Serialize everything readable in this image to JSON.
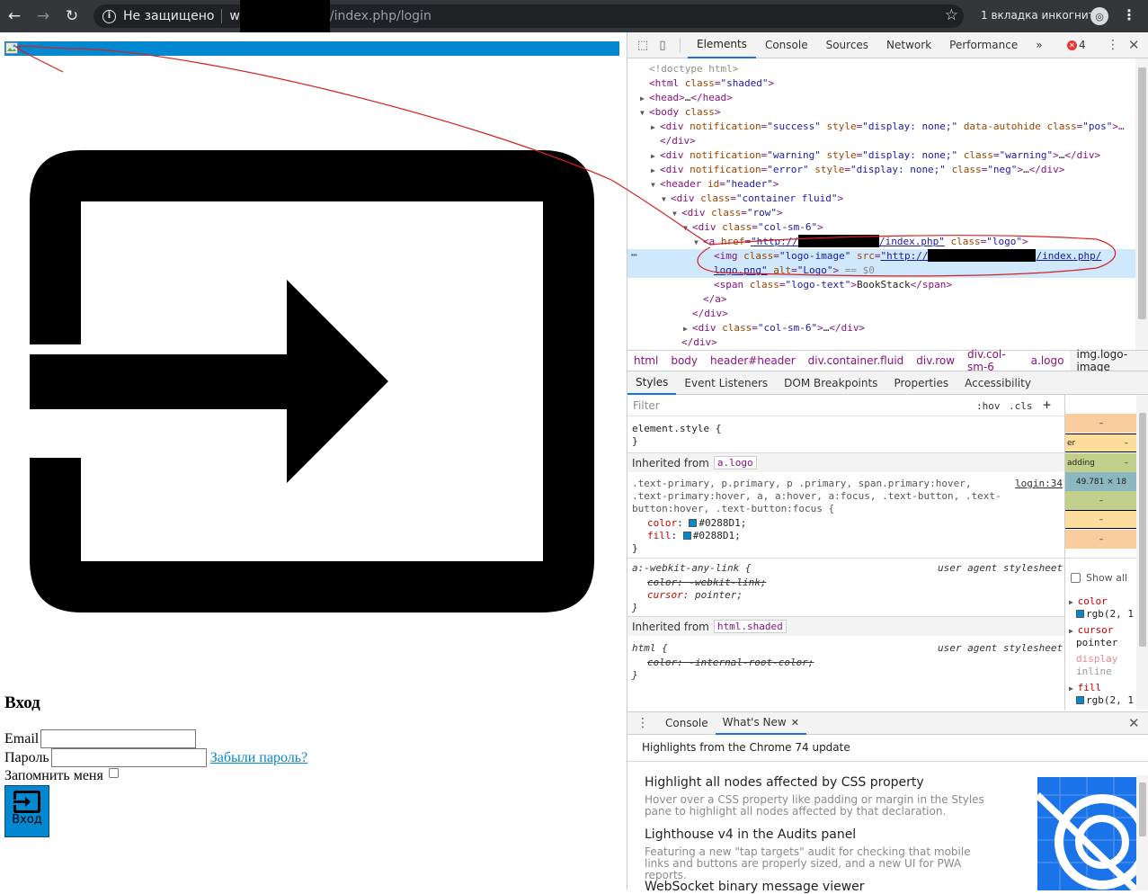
{
  "browser": {
    "security_label": "Не защищено",
    "url_prefix": "w",
    "url_path": "/index.php/login",
    "incognito_label": "1 вкладка инкогнито"
  },
  "page": {
    "login_title": "Вход",
    "email_label": "Email",
    "password_label": "Пароль",
    "forgot_link": "Забыли пароль?",
    "remember_label": "Запомнить меня",
    "login_button": "Вход",
    "accent_color": "#0288D1"
  },
  "devtools": {
    "tabs": [
      "Elements",
      "Console",
      "Sources",
      "Network",
      "Performance",
      "»"
    ],
    "error_count": "4",
    "dom": [
      {
        "indent": 0,
        "arrow": "",
        "parts": [
          [
            "cmt",
            "<!doctype html>"
          ]
        ]
      },
      {
        "indent": 0,
        "arrow": "",
        "parts": [
          [
            "tag",
            "<html "
          ],
          [
            "attr",
            "class"
          ],
          [
            "tag",
            "="
          ],
          [
            "val",
            "\"shaded\""
          ],
          [
            "tag",
            ">"
          ]
        ]
      },
      {
        "indent": 0,
        "arrow": "▶",
        "parts": [
          [
            "tag",
            "<head>"
          ],
          [
            "txt",
            "…"
          ],
          [
            "tag",
            "</head>"
          ]
        ]
      },
      {
        "indent": 0,
        "arrow": "▼",
        "parts": [
          [
            "tag",
            "<body "
          ],
          [
            "attr",
            "class"
          ],
          [
            "tag",
            ">"
          ]
        ]
      },
      {
        "indent": 1,
        "arrow": "▶",
        "parts": [
          [
            "tag",
            "<div "
          ],
          [
            "attr",
            "notification"
          ],
          [
            "tag",
            "="
          ],
          [
            "val",
            "\"success\""
          ],
          [
            "tag",
            " "
          ],
          [
            "attr",
            "style"
          ],
          [
            "tag",
            "="
          ],
          [
            "val",
            "\"display: none;\""
          ],
          [
            "tag",
            " "
          ],
          [
            "attr",
            "data-autohide"
          ],
          [
            "tag",
            " "
          ],
          [
            "attr",
            "class"
          ],
          [
            "tag",
            "="
          ],
          [
            "val",
            "\"pos\""
          ],
          [
            "tag",
            ">…"
          ]
        ]
      },
      {
        "indent": 1,
        "arrow": "",
        "parts": [
          [
            "tag",
            "</div>"
          ]
        ]
      },
      {
        "indent": 1,
        "arrow": "▶",
        "parts": [
          [
            "tag",
            "<div "
          ],
          [
            "attr",
            "notification"
          ],
          [
            "tag",
            "="
          ],
          [
            "val",
            "\"warning\""
          ],
          [
            "tag",
            " "
          ],
          [
            "attr",
            "style"
          ],
          [
            "tag",
            "="
          ],
          [
            "val",
            "\"display: none;\""
          ],
          [
            "tag",
            " "
          ],
          [
            "attr",
            "class"
          ],
          [
            "tag",
            "="
          ],
          [
            "val",
            "\"warning\""
          ],
          [
            "tag",
            ">"
          ],
          [
            "txt",
            "…"
          ],
          [
            "tag",
            "</div>"
          ]
        ]
      },
      {
        "indent": 1,
        "arrow": "▶",
        "parts": [
          [
            "tag",
            "<div "
          ],
          [
            "attr",
            "notification"
          ],
          [
            "tag",
            "="
          ],
          [
            "val",
            "\"error\""
          ],
          [
            "tag",
            " "
          ],
          [
            "attr",
            "style"
          ],
          [
            "tag",
            "="
          ],
          [
            "val",
            "\"display: none;\""
          ],
          [
            "tag",
            " "
          ],
          [
            "attr",
            "class"
          ],
          [
            "tag",
            "="
          ],
          [
            "val",
            "\"neg\""
          ],
          [
            "tag",
            ">"
          ],
          [
            "txt",
            "…"
          ],
          [
            "tag",
            "</div>"
          ]
        ]
      },
      {
        "indent": 1,
        "arrow": "▼",
        "parts": [
          [
            "tag",
            "<header "
          ],
          [
            "attr",
            "id"
          ],
          [
            "tag",
            "="
          ],
          [
            "val",
            "\"header\""
          ],
          [
            "tag",
            ">"
          ]
        ]
      },
      {
        "indent": 2,
        "arrow": "▼",
        "parts": [
          [
            "tag",
            "<div "
          ],
          [
            "attr",
            "class"
          ],
          [
            "tag",
            "="
          ],
          [
            "val",
            "\"container fluid\""
          ],
          [
            "tag",
            ">"
          ]
        ]
      },
      {
        "indent": 3,
        "arrow": "▼",
        "parts": [
          [
            "tag",
            "<div "
          ],
          [
            "attr",
            "class"
          ],
          [
            "tag",
            "="
          ],
          [
            "val",
            "\"row\""
          ],
          [
            "tag",
            ">"
          ]
        ]
      },
      {
        "indent": 4,
        "arrow": "▼",
        "parts": [
          [
            "tag",
            "<div "
          ],
          [
            "attr",
            "class"
          ],
          [
            "tag",
            "="
          ],
          [
            "val",
            "\"col-sm-6\""
          ],
          [
            "tag",
            ">"
          ]
        ]
      },
      {
        "indent": 5,
        "arrow": "▼",
        "parts": [
          [
            "tag",
            "<a "
          ],
          [
            "attr",
            "href"
          ],
          [
            "tag",
            "="
          ],
          [
            "link",
            "\"http://"
          ],
          [
            "redact",
            "████████████"
          ],
          [
            "link",
            "/index.php\""
          ],
          [
            "tag",
            " "
          ],
          [
            "attr",
            "class"
          ],
          [
            "tag",
            "="
          ],
          [
            "val",
            "\"logo\""
          ],
          [
            "tag",
            ">"
          ]
        ]
      },
      {
        "indent": 6,
        "arrow": "",
        "selected": true,
        "parts": [
          [
            "tag",
            "<img "
          ],
          [
            "attr",
            "class"
          ],
          [
            "tag",
            "="
          ],
          [
            "val",
            "\"logo-image\""
          ],
          [
            "tag",
            " "
          ],
          [
            "attr",
            "src"
          ],
          [
            "tag",
            "="
          ],
          [
            "link",
            "\"http://"
          ],
          [
            "redact",
            "████████████████"
          ],
          [
            "link",
            "/index.php/"
          ]
        ]
      },
      {
        "indent": 6,
        "arrow": "",
        "selected": true,
        "parts": [
          [
            "link",
            "logo.png\""
          ],
          [
            "tag",
            " "
          ],
          [
            "attr",
            "alt"
          ],
          [
            "tag",
            "="
          ],
          [
            "val",
            "\"Logo\""
          ],
          [
            "tag",
            ">"
          ],
          [
            "cmt",
            " == $0"
          ]
        ]
      },
      {
        "indent": 6,
        "arrow": "",
        "parts": [
          [
            "tag",
            "<span "
          ],
          [
            "attr",
            "class"
          ],
          [
            "tag",
            "="
          ],
          [
            "val",
            "\"logo-text\""
          ],
          [
            "tag",
            ">"
          ],
          [
            "txt",
            "BookStack"
          ],
          [
            "tag",
            "</span>"
          ]
        ]
      },
      {
        "indent": 5,
        "arrow": "",
        "parts": [
          [
            "tag",
            "</a>"
          ]
        ]
      },
      {
        "indent": 4,
        "arrow": "",
        "parts": [
          [
            "tag",
            "</div>"
          ]
        ]
      },
      {
        "indent": 4,
        "arrow": "▶",
        "parts": [
          [
            "tag",
            "<div "
          ],
          [
            "attr",
            "class"
          ],
          [
            "tag",
            "="
          ],
          [
            "val",
            "\"col-sm-6\""
          ],
          [
            "tag",
            ">"
          ],
          [
            "txt",
            "…"
          ],
          [
            "tag",
            "</div>"
          ]
        ]
      },
      {
        "indent": 3,
        "arrow": "",
        "parts": [
          [
            "tag",
            "</div>"
          ]
        ]
      }
    ],
    "breadcrumbs": [
      "html",
      "body",
      "header#header",
      "div.container.fluid",
      "div.row",
      "div.col-sm-6",
      "a.logo",
      "img.logo-image"
    ],
    "style_tabs": [
      "Styles",
      "Event Listeners",
      "DOM Breakpoints",
      "Properties",
      "Accessibility"
    ],
    "filter_placeholder": "Filter",
    "hov": ":hov",
    "cls": ".cls",
    "styles": {
      "element_style": "element.style {",
      "close_brace": "}",
      "inherited_label": "Inherited from",
      "inherited_a": "a.logo",
      "rule1_selector_1": ".text-primary, p.primary, p .primary, span.primary:hover,",
      "rule1_selector_2": ".text-primary:hover, a, a:hover, a:focus, .text-button, .text-",
      "rule1_selector_3": "button:hover, .text-button:focus {",
      "rule1_source": "login:34",
      "rule1_prop1": "color",
      "rule1_val1": "#0288D1;",
      "rule1_prop2": "fill",
      "rule1_val2": "#0288D1;",
      "rule2_selector": "a:-webkit-any-link {",
      "ua_label": "user agent stylesheet",
      "rule2_prop1": "color: -webkit-link;",
      "rule2_prop2_name": "cursor",
      "rule2_prop2_val": "pointer;",
      "inherited_html": "html.shaded",
      "rule3_selector": "html {",
      "rule3_prop": "color: -internal-root-color;"
    },
    "computed": {
      "content_size": "49.781 × 18",
      "dash": "–",
      "border_label": "er",
      "padding_label": "adding",
      "show_all": "Show all",
      "props": [
        {
          "name": "color",
          "value": "rgb(2, 1"
        },
        {
          "name": "cursor",
          "value": "pointer"
        },
        {
          "name": "display",
          "value": "inline"
        },
        {
          "name": "fill",
          "value": "rgb(2, 1"
        }
      ]
    },
    "drawer_tabs": [
      "Console",
      "What's New"
    ],
    "whats_new_title": "Highlights from the Chrome 74 update",
    "whats_new_items": [
      {
        "title": "Highlight all nodes affected by CSS property",
        "desc": "Hover over a CSS property like padding or margin in the Styles pane to highlight all nodes affected by that declaration."
      },
      {
        "title": "Lighthouse v4 in the Audits panel",
        "desc": "Featuring a new \"tap targets\" audit for checking that mobile links and buttons are properly sized, and a new UI for PWA reports."
      },
      {
        "title": "WebSocket binary message viewer",
        "desc": ""
      }
    ]
  }
}
